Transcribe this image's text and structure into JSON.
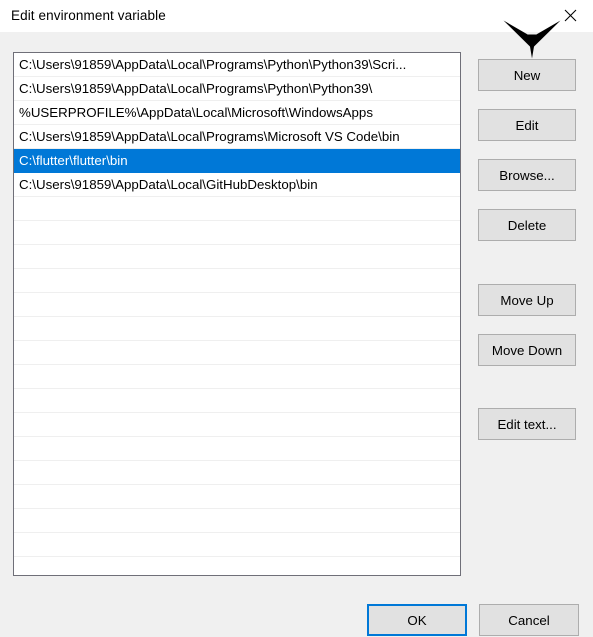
{
  "window": {
    "title": "Edit environment variable",
    "close_icon": "close-icon"
  },
  "listbox": {
    "selected_index": 4,
    "total_rows": 22,
    "items": [
      "C:\\Users\\91859\\AppData\\Local\\Programs\\Python\\Python39\\Scri...",
      "C:\\Users\\91859\\AppData\\Local\\Programs\\Python\\Python39\\",
      "%USERPROFILE%\\AppData\\Local\\Microsoft\\WindowsApps",
      "C:\\Users\\91859\\AppData\\Local\\Programs\\Microsoft VS Code\\bin",
      "C:\\flutter\\flutter\\bin",
      "C:\\Users\\91859\\AppData\\Local\\GitHubDesktop\\bin"
    ]
  },
  "side_buttons": [
    {
      "id": "new",
      "label": "New"
    },
    {
      "id": "edit",
      "label": "Edit"
    },
    {
      "id": "browse",
      "label": "Browse..."
    },
    {
      "id": "delete",
      "label": "Delete"
    },
    {
      "id": "move-up",
      "label": "Move Up"
    },
    {
      "id": "move-down",
      "label": "Move Down"
    },
    {
      "id": "edit-text",
      "label": "Edit text..."
    }
  ],
  "bottom_buttons": {
    "ok_label": "OK",
    "cancel_label": "Cancel"
  },
  "annotation": {
    "name": "down-arrow-annotation",
    "points_at": "New",
    "color": "#000000"
  },
  "colors": {
    "accent": "#0078D7",
    "dialog_background": "#F0F0F0",
    "titlebar_background": "#FFFFFF",
    "button_face": "#E1E1E1",
    "button_border": "#ADADAD",
    "listbox_border": "#6F6F78",
    "listbox_background": "#FFFFFF",
    "row_separator": "#EFEFEF"
  }
}
